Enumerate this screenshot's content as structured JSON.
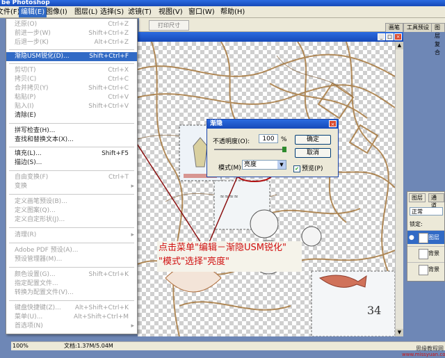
{
  "app": {
    "title": "be Photoshop"
  },
  "menubar": [
    {
      "label": "文件(F)"
    },
    {
      "label": "编辑(E)"
    },
    {
      "label": "图像(I)"
    },
    {
      "label": "图层(L)"
    },
    {
      "label": "选择(S)"
    },
    {
      "label": "滤镜(T)"
    },
    {
      "label": "视图(V)"
    },
    {
      "label": "窗口(W)"
    },
    {
      "label": "帮助(H)"
    }
  ],
  "optionsbar": {
    "print_size": "打印尺寸"
  },
  "palette_tabs": [
    "画笔",
    "工具预设",
    "图层复合"
  ],
  "edit_menu": {
    "items": [
      {
        "label": "还原(O)",
        "shortcut": "Ctrl+Z"
      },
      {
        "label": "前进一步(W)",
        "shortcut": "Shift+Ctrl+Z"
      },
      {
        "label": "后退一步(K)",
        "shortcut": "Alt+Ctrl+Z"
      },
      {
        "label": "渐隐USM锐化(D)...",
        "shortcut": "Shift+Ctrl+F"
      },
      {
        "label": "剪切(T)",
        "shortcut": "Ctrl+X"
      },
      {
        "label": "拷贝(C)",
        "shortcut": "Ctrl+C"
      },
      {
        "label": "合并拷贝(Y)",
        "shortcut": "Shift+Ctrl+C"
      },
      {
        "label": "粘贴(P)",
        "shortcut": "Ctrl+V"
      },
      {
        "label": "贴入(I)",
        "shortcut": "Shift+Ctrl+V"
      },
      {
        "label": "清除(E)",
        "shortcut": ""
      },
      {
        "label": "拼写检查(H)...",
        "shortcut": ""
      },
      {
        "label": "查找和替换文本(X)...",
        "shortcut": ""
      },
      {
        "label": "填充(L)...",
        "shortcut": "Shift+F5"
      },
      {
        "label": "描边(S)...",
        "shortcut": ""
      },
      {
        "label": "自由变换(F)",
        "shortcut": "Ctrl+T"
      },
      {
        "label": "变换",
        "shortcut": "▸"
      },
      {
        "label": "定义画笔预设(B)...",
        "shortcut": ""
      },
      {
        "label": "定义图案(Q)...",
        "shortcut": ""
      },
      {
        "label": "定义自定形状(J)...",
        "shortcut": ""
      },
      {
        "label": "清理(R)",
        "shortcut": "▸"
      },
      {
        "label": "Adobe PDF 预设(A)...",
        "shortcut": ""
      },
      {
        "label": "预设管理器(M)...",
        "shortcut": ""
      },
      {
        "label": "颜色设置(G)...",
        "shortcut": "Shift+Ctrl+K"
      },
      {
        "label": "指定配置文件...",
        "shortcut": ""
      },
      {
        "label": "转换为配置文件(V)...",
        "shortcut": ""
      },
      {
        "label": "键盘快捷键(Z)...",
        "shortcut": "Alt+Shift+Ctrl+K"
      },
      {
        "label": "菜单(U)...",
        "shortcut": "Alt+Shift+Ctrl+M"
      },
      {
        "label": "首选项(N)",
        "shortcut": "▸"
      }
    ]
  },
  "fade_dialog": {
    "title": "渐隐",
    "opacity_label": "不透明度(O):",
    "opacity_value": "100",
    "percent": "%",
    "opacity_level": 1.0,
    "mode_label": "模式(M):",
    "mode_value": "亮度",
    "ok": "确定",
    "cancel": "取消",
    "preview_label": "预览(P)",
    "preview_checked": true
  },
  "layers_panel": {
    "tabs": [
      "图层",
      "通道"
    ],
    "blend_mode": "正常",
    "lock_label": "锁定:",
    "layers": [
      {
        "name": "图层"
      },
      {
        "name": "背景"
      },
      {
        "name": "背景"
      }
    ]
  },
  "annotation": {
    "line1": "点击菜单\"编辑－渐隐USM锐化\"",
    "line2": "\"模式\"选择\"亮度\""
  },
  "statusbar": {
    "zoom": "100%",
    "doc": "文档:1.37M/5.04M"
  },
  "watermark": {
    "line1": "思缘教程网",
    "line2": "www.missyuan.com"
  },
  "colors": {
    "menu_highlight": "#316ac5",
    "annotation": "#d01010",
    "titlebar": "#1649b8"
  }
}
